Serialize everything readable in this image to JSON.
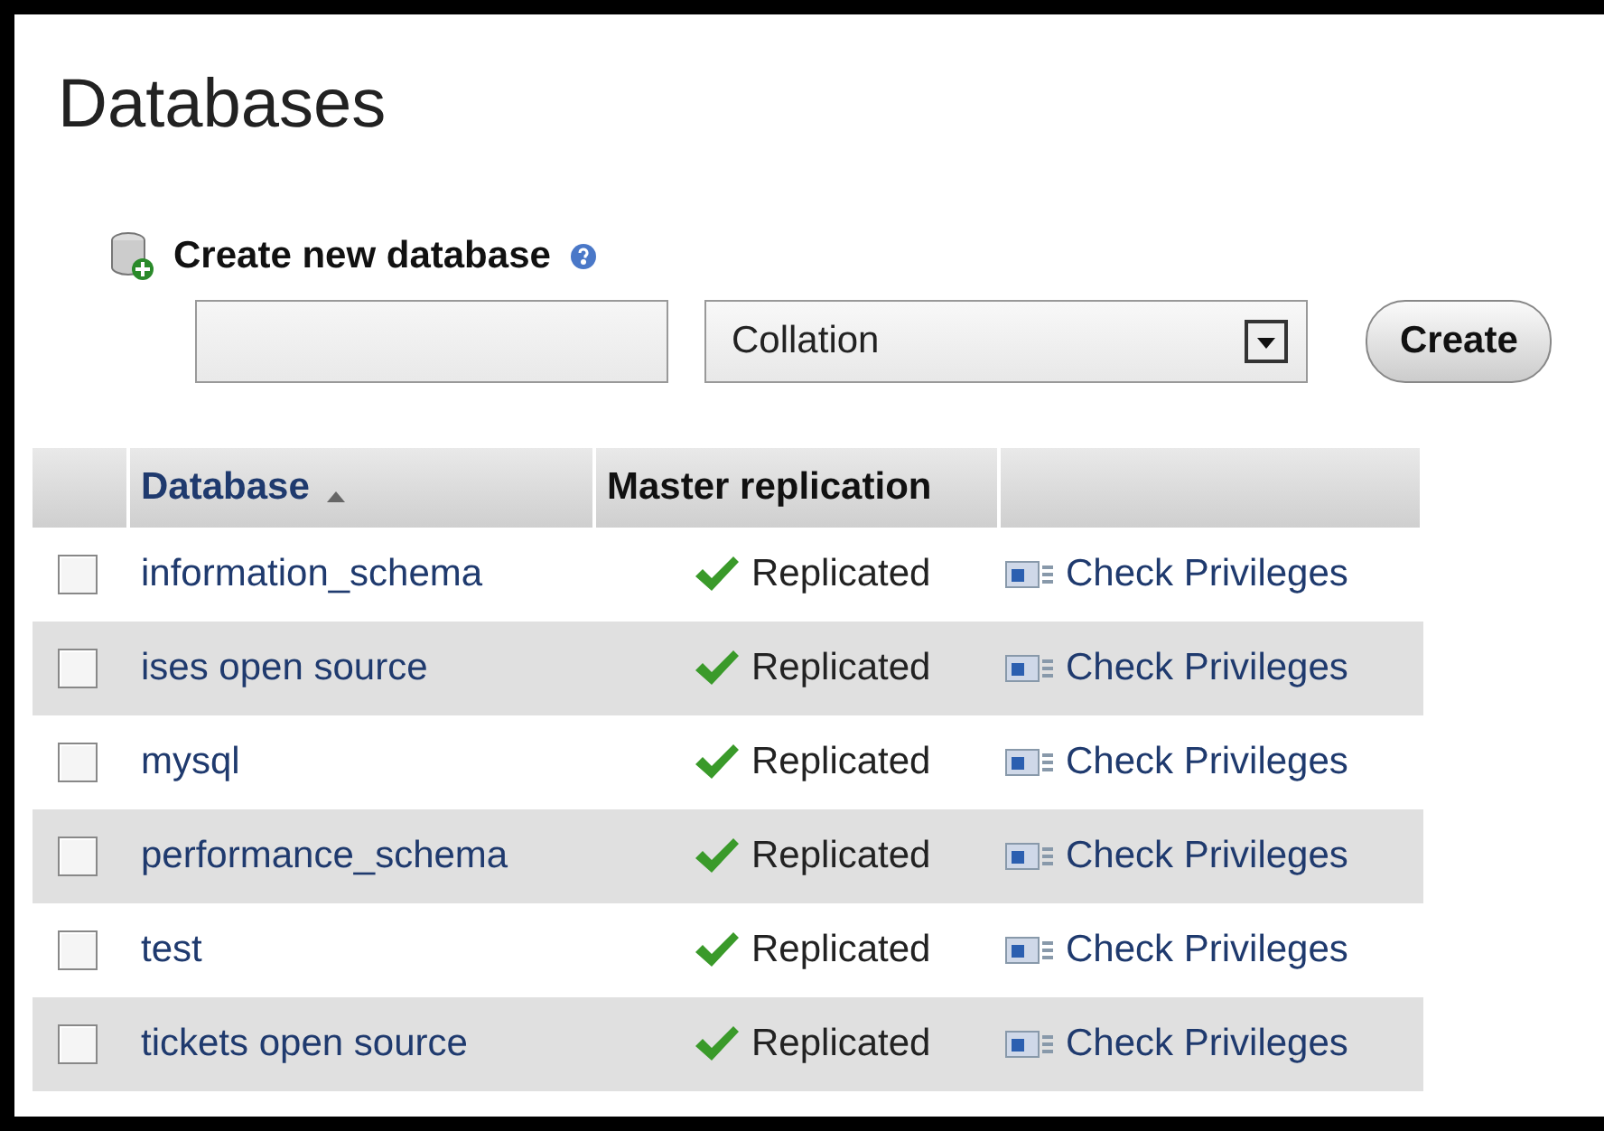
{
  "page_title": "Databases",
  "create": {
    "label": "Create new database",
    "collation_placeholder": "Collation",
    "button": "Create"
  },
  "table": {
    "columns": [
      {
        "label": "Database",
        "sorted": true
      },
      {
        "label": "Master replication",
        "sorted": false
      }
    ],
    "rows": [
      {
        "checked": false,
        "name": "information_schema",
        "status": "Replicated",
        "action": "Check Privileges"
      },
      {
        "checked": false,
        "name": "ises open source",
        "status": "Replicated",
        "action": "Check Privileges"
      },
      {
        "checked": false,
        "name": "mysql",
        "status": "Replicated",
        "action": "Check Privileges"
      },
      {
        "checked": false,
        "name": "performance_schema",
        "status": "Replicated",
        "action": "Check Privileges"
      },
      {
        "checked": false,
        "name": "test",
        "status": "Replicated",
        "action": "Check Privileges"
      },
      {
        "checked": false,
        "name": "tickets open source",
        "status": "Replicated",
        "action": "Check Privileges"
      }
    ]
  }
}
